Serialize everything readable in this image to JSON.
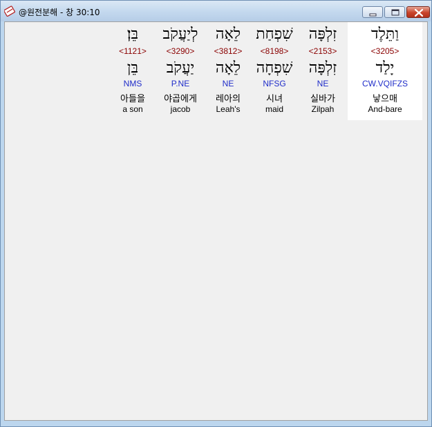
{
  "window": {
    "title": "@원전분해 - 창 30:10"
  },
  "words": [
    {
      "hebrew": "וַתֵּלֶד",
      "strong": "<3205>",
      "root": "יָלַד",
      "parse": "CW.VQIFZS",
      "korean": "낳으매",
      "english": "And-bare"
    },
    {
      "hebrew": "זִלְפָּה",
      "strong": "<2153>",
      "root": "זִלְפָּה",
      "parse": "NE",
      "korean": "실바가",
      "english": "Zilpah"
    },
    {
      "hebrew": "שִׁפְחַת",
      "strong": "<8198>",
      "root": "שִׁפְחָה",
      "parse": "NFSG",
      "korean": "시녀",
      "english": "maid"
    },
    {
      "hebrew": "לֵאָה",
      "strong": "<3812>",
      "root": "לֵאָה",
      "parse": "NE",
      "korean": "레아의",
      "english": "Leah's"
    },
    {
      "hebrew": "לְיַעֲקֹב",
      "strong": "<3290>",
      "root": "יַעֲקֹב",
      "parse": "P.NE",
      "korean": "야곱에게",
      "english": "jacob"
    },
    {
      "hebrew": "בֵּן׃",
      "strong": "<1121>",
      "root": "בֵּן",
      "parse": "NMS",
      "korean": "아들을",
      "english": "a son"
    }
  ]
}
